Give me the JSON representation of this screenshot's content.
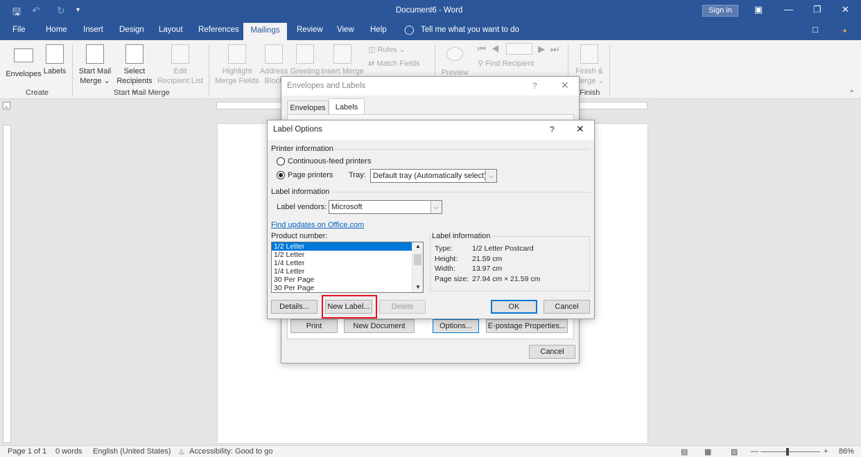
{
  "window": {
    "title": "Document6  -  Word",
    "sign_in": "Sign in"
  },
  "tabs": [
    "File",
    "Home",
    "Insert",
    "Design",
    "Layout",
    "References",
    "Mailings",
    "Review",
    "View",
    "Help"
  ],
  "tell_me": "Tell me what you want to do",
  "ribbon": {
    "envelopes": "Envelopes",
    "labels": "Labels",
    "start_mail_merge_1": "Start Mail",
    "start_mail_merge_2": "Merge ⌄",
    "select_recipients_1": "Select",
    "select_recipients_2": "Recipients ⌄",
    "edit_list_1": "Edit",
    "edit_list_2": "Recipient List",
    "highlight_1": "Highlight",
    "highlight_2": "Merge Fields",
    "address_1": "Address",
    "address_2": "Block",
    "greeting_1": "Greeting",
    "insert_merge_1": "Insert Merge",
    "rules": "Rules ⌄",
    "match_fields": "Match Fields",
    "preview": "Preview",
    "find_recipient": "Find Recipient",
    "finish_1": "Finish &",
    "finish_2": "Merge ⌄",
    "group_create": "Create",
    "group_start": "Start Mail Merge",
    "group_finish": "Finish"
  },
  "env_dialog": {
    "title": "Envelopes and Labels",
    "help": "?",
    "tab_envelopes": "Envelopes",
    "tab_labels": "Labels",
    "print": "Print",
    "new_document": "New Document",
    "options": "Options...",
    "epostage": "E-postage Properties...",
    "cancel": "Cancel"
  },
  "label_dialog": {
    "title": "Label Options",
    "help": "?",
    "printer_info": "Printer information",
    "continuous": "Continuous-feed printers",
    "page_printers": "Page printers",
    "tray_label": "Tray:",
    "tray_value": "Default tray (Automatically select)",
    "label_info_section": "Label information",
    "vendors_label": "Label vendors:",
    "vendors_value": "Microsoft",
    "find_updates": "Find updates on Office.com",
    "product_number": "Product number:",
    "products": [
      "1/2 Letter",
      "1/2 Letter",
      "1/4 Letter",
      "1/4 Letter",
      "30 Per Page",
      "30 Per Page"
    ],
    "info_title": "Label information",
    "type_label": "Type:",
    "type_value": "1/2 Letter Postcard",
    "height_label": "Height:",
    "height_value": "21.59 cm",
    "width_label": "Width:",
    "width_value": "13.97 cm",
    "pagesize_label": "Page size:",
    "pagesize_value": "27.94 cm × 21.59 cm",
    "details": "Details...",
    "new_label": "New Label...",
    "delete": "Delete",
    "ok": "OK",
    "cancel": "Cancel"
  },
  "status": {
    "page": "Page 1 of 1",
    "words": "0 words",
    "language": "English (United States)",
    "accessibility": "Accessibility: Good to go",
    "zoom": "86%"
  },
  "highlight_color": "#e81123"
}
